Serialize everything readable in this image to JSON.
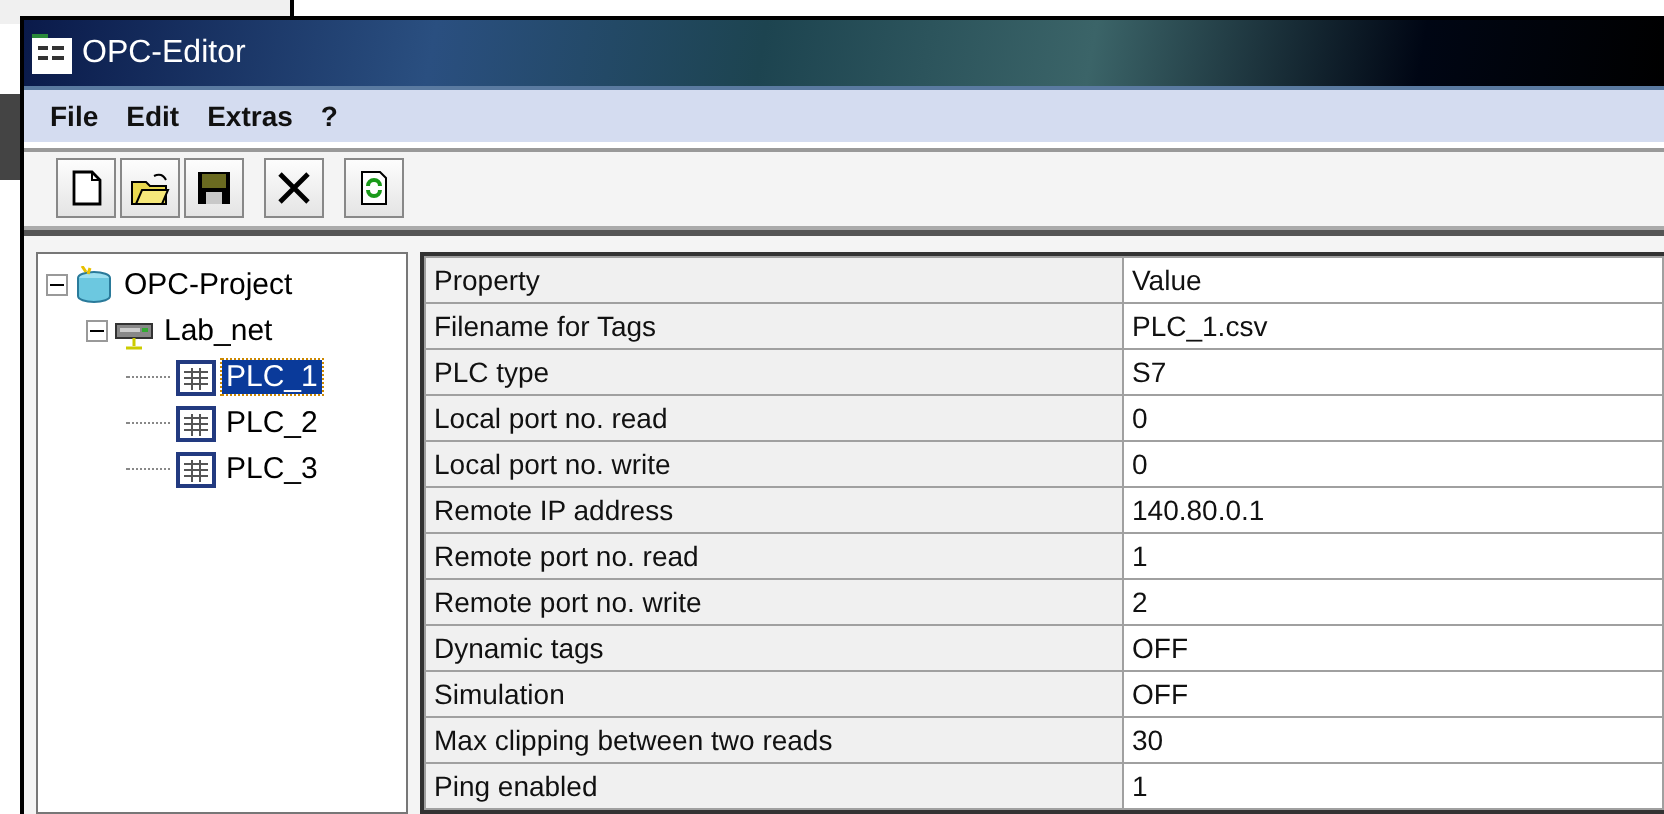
{
  "window": {
    "title": "OPC-Editor"
  },
  "menu": [
    "File",
    "Edit",
    "Extras",
    "?"
  ],
  "toolbar": [
    {
      "kind": "new"
    },
    {
      "kind": "open"
    },
    {
      "kind": "save"
    },
    {
      "kind": "delete"
    },
    {
      "kind": "refresh"
    }
  ],
  "tree": [
    {
      "label": "OPC-Project",
      "kind": "project",
      "expanded": true,
      "selected": false,
      "children": [
        {
          "label": "Lab_net",
          "kind": "network",
          "expanded": true,
          "selected": false,
          "children": [
            {
              "label": "PLC_1",
              "kind": "plc",
              "selected": true
            },
            {
              "label": "PLC_2",
              "kind": "plc",
              "selected": false
            },
            {
              "label": "PLC_3",
              "kind": "plc",
              "selected": false
            }
          ]
        }
      ]
    }
  ],
  "table": {
    "columns": [
      "Property",
      "Value"
    ],
    "rows": [
      [
        "Filename for Tags",
        "PLC_1.csv"
      ],
      [
        "PLC type",
        "S7"
      ],
      [
        "Local port no. read",
        "0"
      ],
      [
        "Local port no. write",
        "0"
      ],
      [
        "Remote IP address",
        "140.80.0.1"
      ],
      [
        "Remote port no. read",
        "1"
      ],
      [
        "Remote port no. write",
        "2"
      ],
      [
        "Dynamic tags",
        "OFF"
      ],
      [
        "Simulation",
        "OFF"
      ],
      [
        "Max clipping between two reads",
        "30"
      ],
      [
        "Ping enabled",
        "1"
      ]
    ]
  }
}
